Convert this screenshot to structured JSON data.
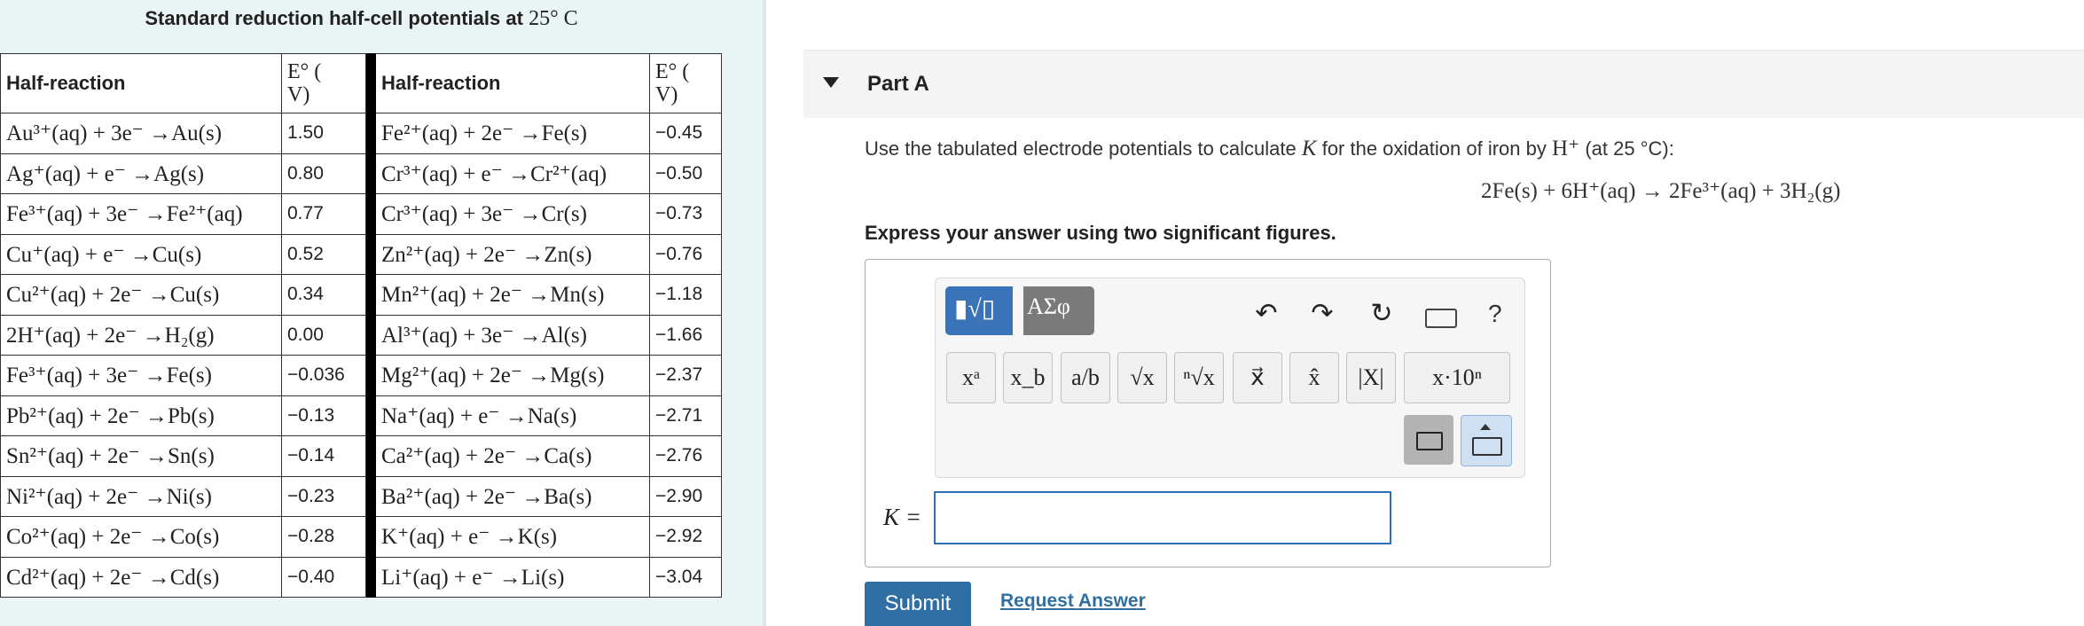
{
  "table": {
    "title": "Standard reduction half-cell potentials at",
    "title_temp": "25° C",
    "headers": {
      "half_reaction": "Half-reaction",
      "potential_line1": "E° (",
      "potential_line2": "V)"
    },
    "left_rows": [
      {
        "reaction": "Au³⁺(aq) + 3e⁻ →Au(s)",
        "potential": "1.50"
      },
      {
        "reaction": "Ag⁺(aq) + e⁻ →Ag(s)",
        "potential": "0.80"
      },
      {
        "reaction": "Fe³⁺(aq) + 3e⁻ →Fe²⁺(aq)",
        "potential": "0.77"
      },
      {
        "reaction": "Cu⁺(aq) + e⁻ →Cu(s)",
        "potential": "0.52"
      },
      {
        "reaction": "Cu²⁺(aq) + 2e⁻ →Cu(s)",
        "potential": "0.34"
      },
      {
        "reaction": "2H⁺(aq) + 2e⁻ →H₂(g)",
        "potential": "0.00"
      },
      {
        "reaction": "Fe³⁺(aq) + 3e⁻ →Fe(s)",
        "potential": "−0.036"
      },
      {
        "reaction": "Pb²⁺(aq) + 2e⁻ →Pb(s)",
        "potential": "−0.13"
      },
      {
        "reaction": "Sn²⁺(aq) + 2e⁻ →Sn(s)",
        "potential": "−0.14"
      },
      {
        "reaction": "Ni²⁺(aq) + 2e⁻ →Ni(s)",
        "potential": "−0.23"
      },
      {
        "reaction": "Co²⁺(aq) + 2e⁻ →Co(s)",
        "potential": "−0.28"
      },
      {
        "reaction": "Cd²⁺(aq) + 2e⁻ →Cd(s)",
        "potential": "−0.40"
      }
    ],
    "right_rows": [
      {
        "reaction": "Fe²⁺(aq) + 2e⁻ →Fe(s)",
        "potential": "−0.45"
      },
      {
        "reaction": "Cr³⁺(aq) + e⁻ →Cr²⁺(aq)",
        "potential": "−0.50"
      },
      {
        "reaction": "Cr³⁺(aq) + 3e⁻ →Cr(s)",
        "potential": "−0.73"
      },
      {
        "reaction": "Zn²⁺(aq) + 2e⁻ →Zn(s)",
        "potential": "−0.76"
      },
      {
        "reaction": "Mn²⁺(aq) + 2e⁻ →Mn(s)",
        "potential": "−1.18"
      },
      {
        "reaction": "Al³⁺(aq) + 3e⁻ →Al(s)",
        "potential": "−1.66"
      },
      {
        "reaction": "Mg²⁺(aq) + 2e⁻ →Mg(s)",
        "potential": "−2.37"
      },
      {
        "reaction": "Na⁺(aq) + e⁻ →Na(s)",
        "potential": "−2.71"
      },
      {
        "reaction": "Ca²⁺(aq) + 2e⁻ →Ca(s)",
        "potential": "−2.76"
      },
      {
        "reaction": "Ba²⁺(aq) + 2e⁻ →Ba(s)",
        "potential": "−2.90"
      },
      {
        "reaction": "K⁺(aq) + e⁻ →K(s)",
        "potential": "−2.92"
      },
      {
        "reaction": "Li⁺(aq) + e⁻ →Li(s)",
        "potential": "−3.04"
      }
    ]
  },
  "part": {
    "title": "Part A",
    "question_prefix": "Use the tabulated electrode potentials to calculate",
    "question_var": "K",
    "question_mid": "for the oxidation of iron by",
    "question_ion": "H⁺",
    "question_suffix": "(at 25 °C):",
    "equation": "2Fe(s) + 6H⁺(aq) → 2Fe³⁺(aq) + 3H₂(g)",
    "instruction": "Express your answer using two significant figures."
  },
  "toolbar": {
    "templates_label": "▮√▯",
    "greek_label": "ΑΣφ",
    "undo_icon": "↶",
    "redo_icon": "↷",
    "reset_icon": "↻",
    "help_label": "?",
    "math_buttons": [
      "xᵃ",
      "x_b",
      "a/b",
      "√x",
      "ⁿ√x",
      "x⃗",
      "x̂",
      "|X|",
      "x·10ⁿ"
    ]
  },
  "answer": {
    "label": "K =",
    "value": ""
  },
  "actions": {
    "submit": "Submit",
    "request_answer": "Request Answer"
  },
  "colors": {
    "left_panel_bg": "#e9f5f4",
    "accent_blue": "#2f6fa3",
    "toolbar_blue": "#3b73b9"
  }
}
